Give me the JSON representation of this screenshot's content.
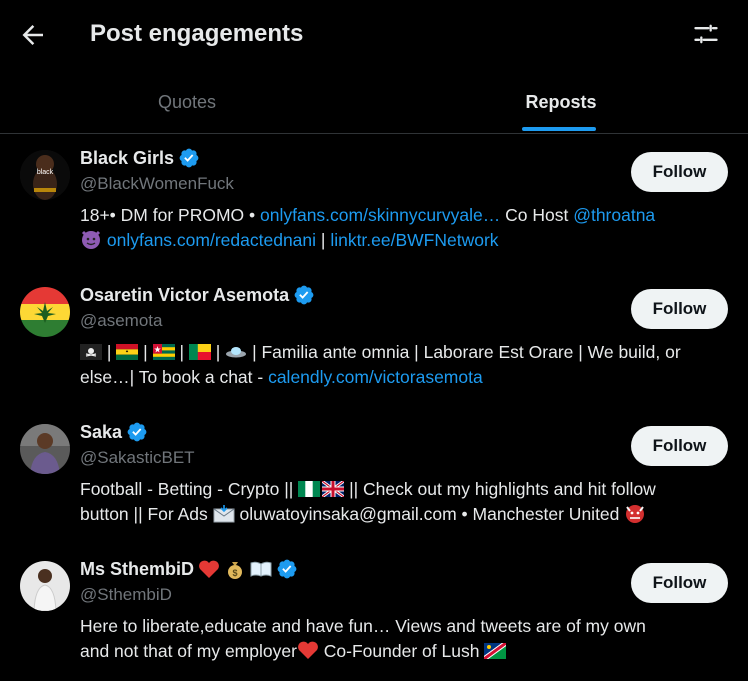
{
  "header": {
    "title": "Post engagements"
  },
  "tabs": [
    {
      "label": "Quotes",
      "active": false
    },
    {
      "label": "Reposts",
      "active": true
    }
  ],
  "colors": {
    "background": "#000000",
    "text": "#e7e9ea",
    "muted": "#71767b",
    "accent": "#1d9bf0",
    "follow_bg": "#eff3f4"
  },
  "users": [
    {
      "name": "Black Girls",
      "handle": "@BlackWomenFuck",
      "verified": true,
      "follow_label": "Follow",
      "bio": {
        "t1": "18+• DM for PROMO • ",
        "l1": "onlyfans.com/skinnycurvyale…",
        "t2": " Co Host ",
        "l2": "@throatna",
        "l3": "onlyfans.com/redactednani",
        "t3": " | ",
        "l4": "linktr.ee/BWFNetwork"
      },
      "avatar_text": "black"
    },
    {
      "name": "Osaretin Victor Asemota",
      "handle": "@asemota",
      "verified": true,
      "follow_label": "Follow",
      "bio": {
        "t1": "| Familia ante omnia | Laborare Est Orare | We build, or",
        "t2": "else…| To book a chat - ",
        "l1": "calendly.com/victorasemota"
      }
    },
    {
      "name": "Saka",
      "handle": "@SakasticBET",
      "verified": true,
      "follow_label": "Follow",
      "bio": {
        "t1": "Football - Betting - Crypto || ",
        "t2": " || Check out my highlights and hit follow",
        "t3": "button || For Ads ",
        "t4": " oluwatoyinsaka@gmail.com • Manchester United "
      }
    },
    {
      "name": "Ms SthembiD",
      "handle": "@SthembiD",
      "verified": true,
      "follow_label": "Follow",
      "bio": {
        "t1": "Here to liberate,educate and have fun… Views and tweets are of my own",
        "t2": "and not that of my employer",
        "t3": " Co-Founder of Lush "
      }
    }
  ]
}
